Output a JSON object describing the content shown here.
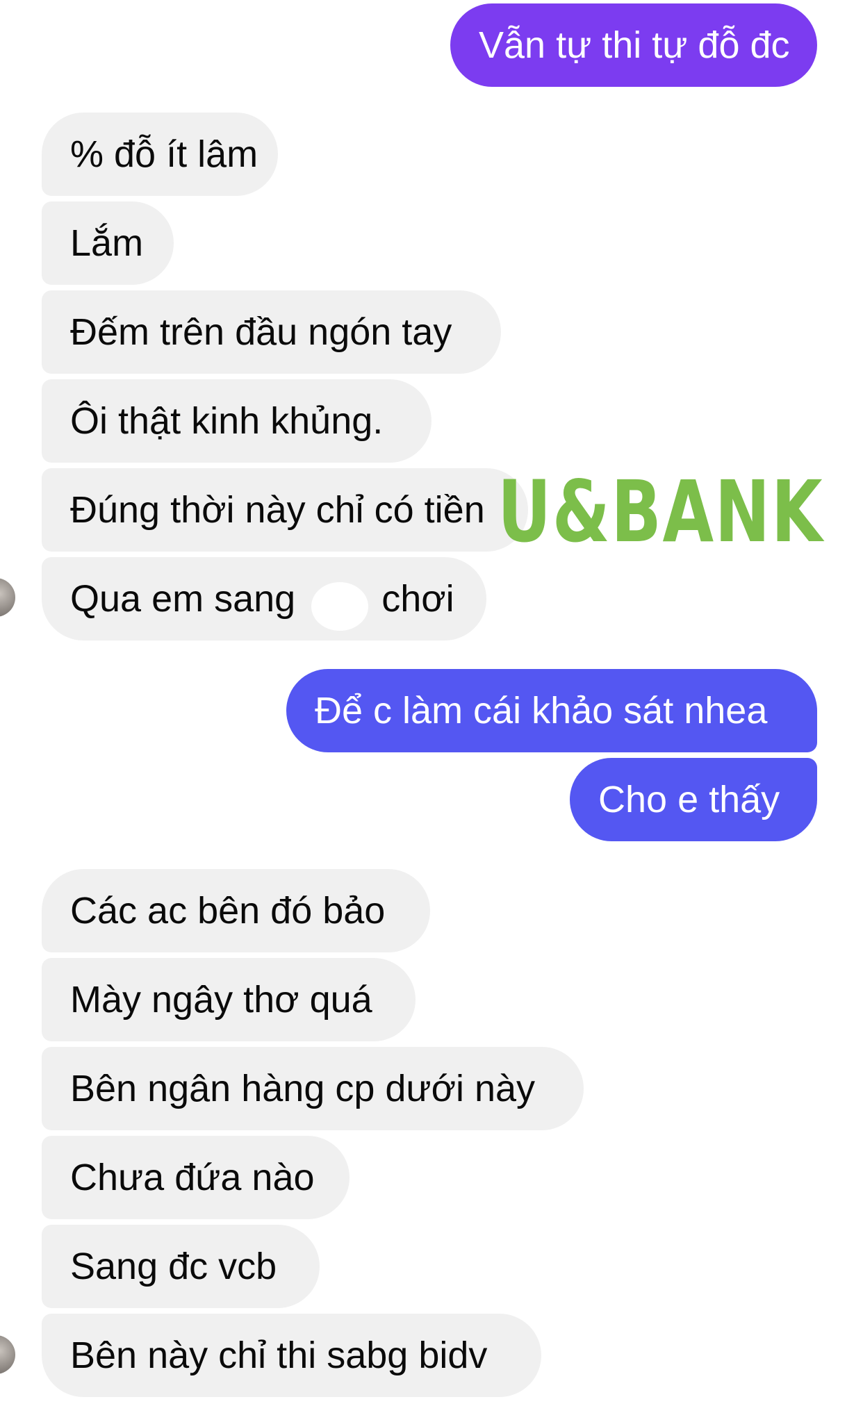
{
  "colors": {
    "incoming_bubble": "#f0f0f0",
    "outgoing_purple": "#7c3cf0",
    "outgoing_blue": "#5457f2",
    "watermark": "#7cbe4a"
  },
  "messages": [
    {
      "id": "m1",
      "side": "outgoing",
      "text": "Vẫn tự thi tự đỗ đc"
    },
    {
      "id": "m2",
      "side": "incoming",
      "text": "% đỗ ít lâm"
    },
    {
      "id": "m3",
      "side": "incoming",
      "text": "Lắm"
    },
    {
      "id": "m4",
      "side": "incoming",
      "text": "Đếm trên đầu ngón tay"
    },
    {
      "id": "m5",
      "side": "incoming",
      "text": "Ôi thật kinh khủng."
    },
    {
      "id": "m6",
      "side": "incoming",
      "text": "Đúng thời này chỉ có tiền"
    },
    {
      "id": "m7a",
      "side": "incoming",
      "text": "Qua em sang"
    },
    {
      "id": "m7b",
      "side": "incoming",
      "text": "chơi"
    },
    {
      "id": "m8",
      "side": "outgoing",
      "text": "Để c làm cái khảo sát nhea"
    },
    {
      "id": "m9",
      "side": "outgoing",
      "text": "Cho e thấy"
    },
    {
      "id": "m10",
      "side": "incoming",
      "text": "Các ac bên đó bảo"
    },
    {
      "id": "m11",
      "side": "incoming",
      "text": "Mày ngây thơ quá"
    },
    {
      "id": "m12",
      "side": "incoming",
      "text": "Bên ngân hàng cp dưới này"
    },
    {
      "id": "m13",
      "side": "incoming",
      "text": "Chưa đứa nào"
    },
    {
      "id": "m14",
      "side": "incoming",
      "text": "Sang đc vcb"
    },
    {
      "id": "m15",
      "side": "incoming",
      "text": "Bên này chỉ thi sabg bidv"
    }
  ],
  "watermark": {
    "text": "U&BANK"
  }
}
